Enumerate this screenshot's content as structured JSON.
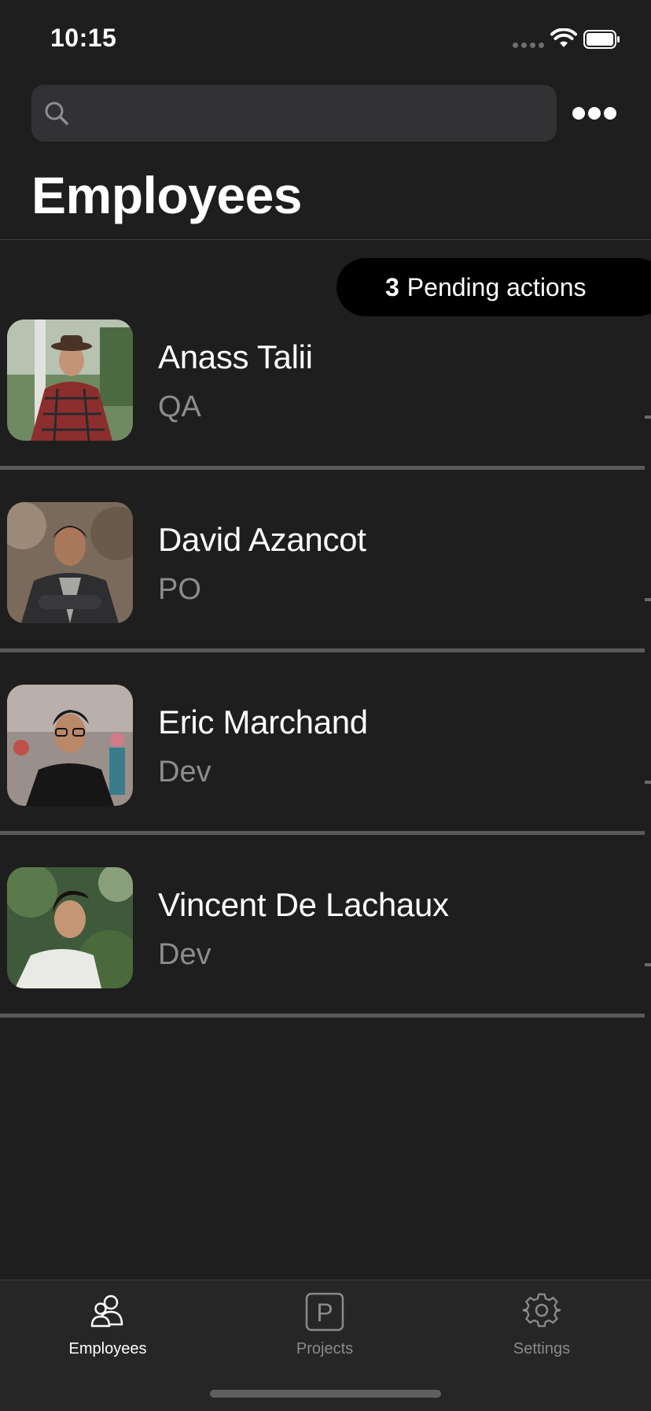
{
  "status_bar": {
    "time": "10:15"
  },
  "search": {
    "value": "",
    "placeholder": ""
  },
  "header": {
    "title": "Employees",
    "more_icon": "more-horizontal-icon"
  },
  "pending": {
    "count": "3",
    "label": "Pending actions"
  },
  "employees": [
    {
      "name": "Anass Talii",
      "role": "QA"
    },
    {
      "name": "David Azancot",
      "role": "PO"
    },
    {
      "name": "Eric Marchand",
      "role": "Dev"
    },
    {
      "name": "Vincent De Lachaux",
      "role": "Dev"
    }
  ],
  "tab_bar": {
    "active_color": "#ffffff",
    "inactive_color": "#8a8a8a",
    "tabs": [
      {
        "label": "Employees",
        "icon": "users-icon",
        "active": true
      },
      {
        "label": "Projects",
        "icon": "projects-icon",
        "active": false
      },
      {
        "label": "Settings",
        "icon": "gear-icon",
        "active": false
      }
    ]
  },
  "colors": {
    "background": "#1e1e1e",
    "search_background": "#323234",
    "pill_background": "#000000",
    "role_text": "#8c8c8c"
  }
}
